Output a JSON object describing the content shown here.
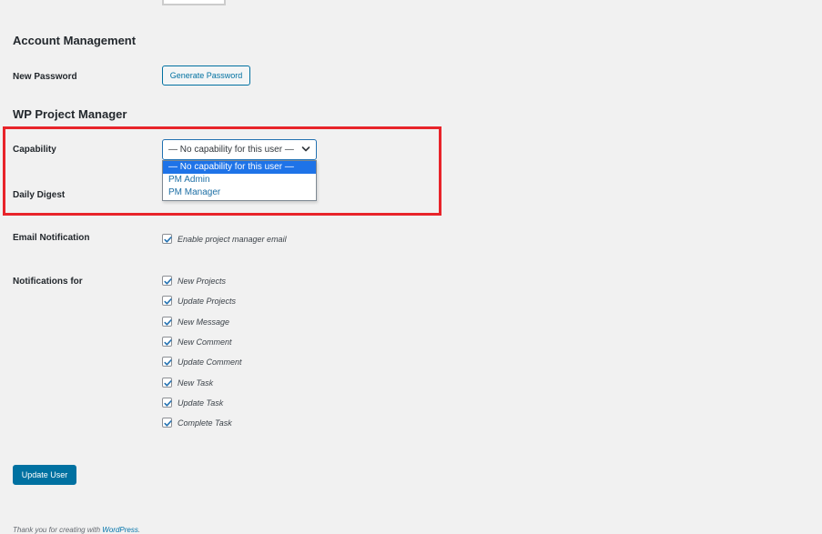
{
  "account": {
    "section_title": "Account Management",
    "password_label": "New Password",
    "generate_button": "Generate Password"
  },
  "pm": {
    "section_title": "WP Project Manager",
    "capability_label": "Capability",
    "capability_value": "— No capability for this user —",
    "capability_options": [
      "— No capability for this user —",
      "PM Admin",
      "PM Manager"
    ],
    "daily_digest_label": "Daily Digest"
  },
  "email": {
    "label": "Email Notification",
    "checkbox_label": "Enable project manager email",
    "checked": true
  },
  "notifications": {
    "label": "Notifications for",
    "items": [
      {
        "label": "New Projects",
        "checked": true
      },
      {
        "label": "Update Projects",
        "checked": true
      },
      {
        "label": "New Message",
        "checked": true
      },
      {
        "label": "New Comment",
        "checked": true
      },
      {
        "label": "Update Comment",
        "checked": true
      },
      {
        "label": "New Task",
        "checked": true
      },
      {
        "label": "Update Task",
        "checked": true
      },
      {
        "label": "Complete Task",
        "checked": true
      }
    ]
  },
  "actions": {
    "update_button": "Update User"
  },
  "footer": {
    "text": "Thank you for creating with ",
    "link": "WordPress",
    "suffix": "."
  },
  "colors": {
    "accent": "#0071a1",
    "highlight_border": "#e8242a",
    "selected_option": "#1e73e8"
  }
}
